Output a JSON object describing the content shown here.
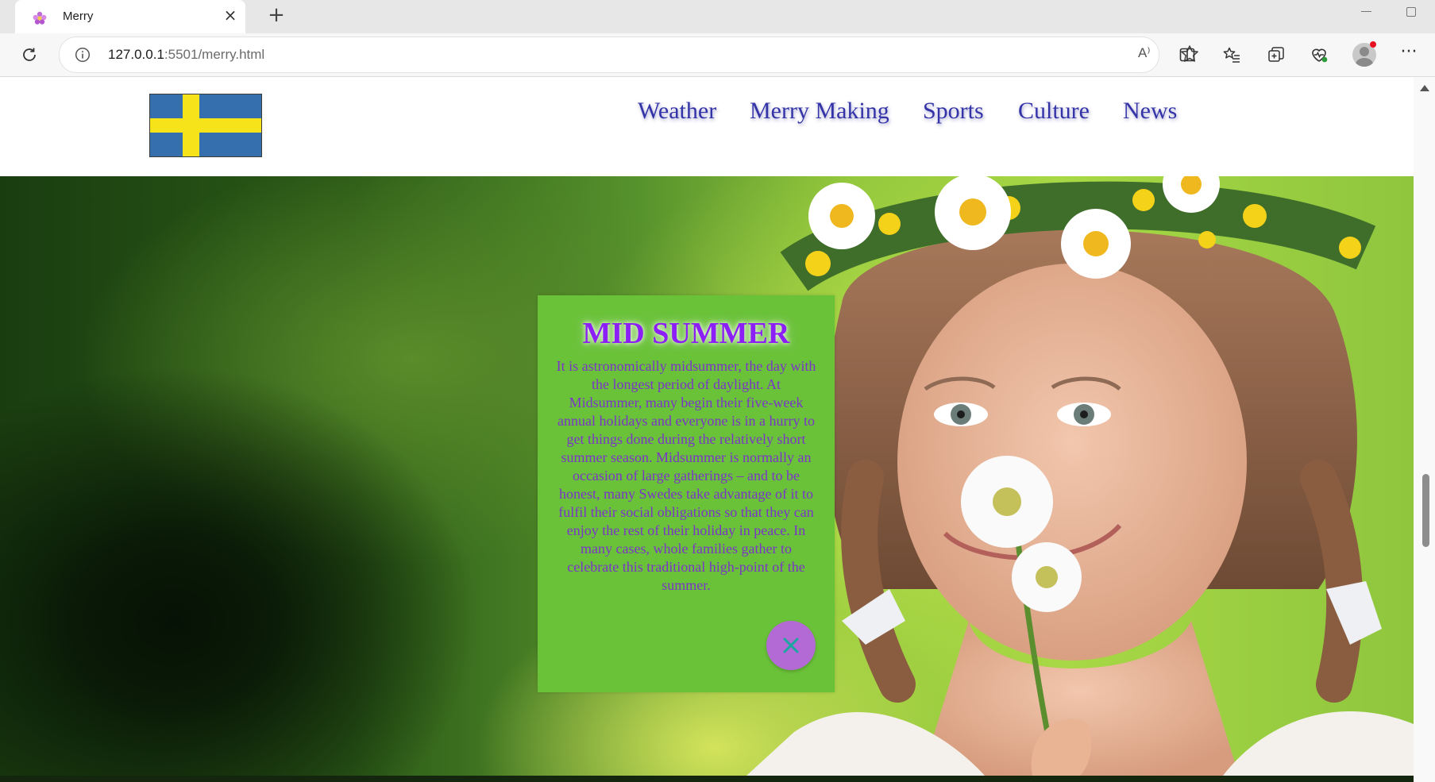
{
  "browser": {
    "tab_title": "Merry",
    "url_host": "127.0.0.1",
    "url_rest": ":5501/merry.html",
    "read_aloud_label": "A⁾"
  },
  "nav": {
    "items": [
      "Weather",
      "Merry Making",
      "Sports",
      "Culture",
      "News"
    ]
  },
  "card": {
    "title": "MID SUMMER",
    "body": "It is astronomically midsummer, the day with the longest period of daylight. At Midsummer, many begin their five-week annual holidays and everyone is in a hurry to get things done during the relatively short summer season. Midsummer is normally an occasion of large gatherings – and to be honest, many Swedes take advantage of it to fulfil their social obligations so that they can enjoy the rest of their holiday in peace. In many cases, whole families gather to celebrate this traditional high-point of the summer.",
    "close_icon": "close-icon"
  },
  "colors": {
    "nav_text": "#3434a8",
    "card_bg": "#6ac239",
    "card_title": "#8b1ff5",
    "card_text": "#7a35c8",
    "close_button": "#b36ad4",
    "flag_blue": "#356fae",
    "flag_yellow": "#f7e31a"
  }
}
